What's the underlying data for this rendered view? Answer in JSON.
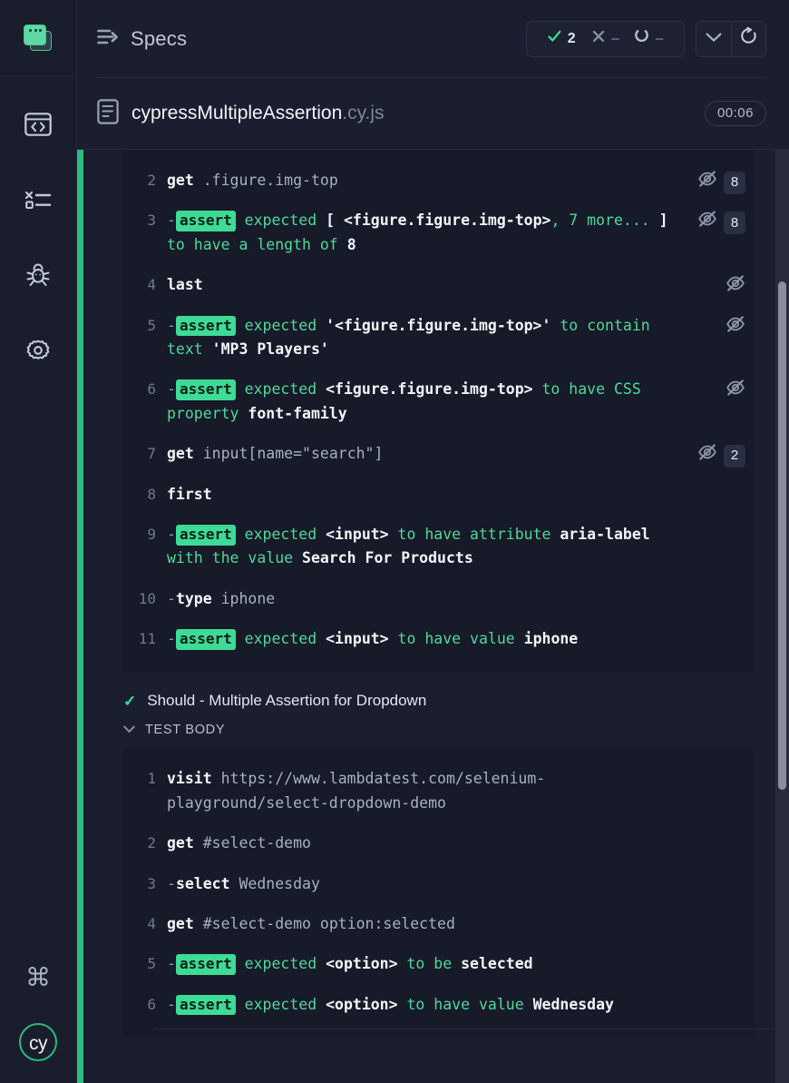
{
  "accent": {
    "green": "#2dbd7f",
    "assert_green": "#3ddb96",
    "code_green": "#4fd89b",
    "bg": "#1b1e2e",
    "code_bg": "#171a28"
  },
  "sidebar": {
    "project_icon": "project-stack-icon",
    "items": [
      {
        "name": "specs",
        "icon": "code-browser-icon"
      },
      {
        "name": "runs",
        "icon": "test-results-list-icon"
      },
      {
        "name": "debug",
        "icon": "bug-icon"
      },
      {
        "name": "settings",
        "icon": "gear-icon"
      }
    ],
    "bottom": [
      {
        "name": "keyboard-shortcuts",
        "icon": "command-key-icon",
        "glyph": "⌘"
      },
      {
        "name": "cypress-logo",
        "icon": "cypress-logo-icon",
        "label": "cy"
      }
    ]
  },
  "header": {
    "icon": "specs-list-arrow-icon",
    "title": "Specs",
    "stats": [
      {
        "name": "passed",
        "icon": "check-icon",
        "value": "2"
      },
      {
        "name": "failed",
        "icon": "x-icon",
        "value": "--"
      },
      {
        "name": "pending",
        "icon": "pending-circle-icon",
        "value": "--"
      }
    ],
    "buttons": [
      {
        "name": "collapse-all",
        "icon": "chevron-down-icon"
      },
      {
        "name": "rerun",
        "icon": "refresh-icon"
      }
    ]
  },
  "spec": {
    "icon": "file-document-icon",
    "name": "cypressMultipleAssertion",
    "extension": ".cy.js",
    "duration": "00:06"
  },
  "blocks": [
    {
      "id": "first-test-log",
      "lines": [
        {
          "num": "2",
          "cmd": "get",
          "arg": ".figure.img-top",
          "kind": "command",
          "hidden_icon": true,
          "count": "8"
        },
        {
          "num": "3",
          "prefix": "-",
          "badge": "assert",
          "message": "expected [ <figure.figure.img-top>, 7 more... ] to have a length of 8",
          "kind": "assert",
          "hidden_icon": true,
          "count": "8"
        },
        {
          "num": "4",
          "cmd": "last",
          "arg": "",
          "kind": "command",
          "hidden_icon": true,
          "count": ""
        },
        {
          "num": "5",
          "prefix": "-",
          "badge": "assert",
          "message": "expected '<figure.figure.img-top>' to contain text 'MP3 Players'",
          "kind": "assert",
          "hidden_icon": true,
          "count": ""
        },
        {
          "num": "6",
          "prefix": "-",
          "badge": "assert",
          "message": "expected <figure.figure.img-top> to have CSS property font-family",
          "kind": "assert",
          "hidden_icon": true,
          "count": ""
        },
        {
          "num": "7",
          "cmd": "get",
          "arg": "input[name=\"search\"]",
          "kind": "command",
          "hidden_icon": true,
          "count": "2"
        },
        {
          "num": "8",
          "cmd": "first",
          "arg": "",
          "kind": "command",
          "hidden_icon": false,
          "count": ""
        },
        {
          "num": "9",
          "prefix": "-",
          "badge": "assert",
          "message": "expected <input> to have attribute aria-label with the value Search For Products",
          "kind": "assert",
          "hidden_icon": false,
          "count": ""
        },
        {
          "num": "10",
          "prefix": "-",
          "cmd": "type",
          "arg": "iphone",
          "kind": "command",
          "hidden_icon": false,
          "count": ""
        },
        {
          "num": "11",
          "prefix": "-",
          "badge": "assert",
          "message": "expected <input> to have value iphone",
          "kind": "assert",
          "hidden_icon": false,
          "count": ""
        }
      ]
    }
  ],
  "test": {
    "status_icon": "check-icon",
    "title": "Should - Multiple Assertion for Dropdown",
    "section_toggle_icon": "chevron-down-icon",
    "section_label": "TEST BODY",
    "lines": [
      {
        "num": "1",
        "cmd": "visit",
        "arg": "https://www.lambdatest.com/selenium-playground/select-dropdown-demo",
        "kind": "command"
      },
      {
        "num": "2",
        "cmd": "get",
        "arg": "#select-demo",
        "kind": "command"
      },
      {
        "num": "3",
        "prefix": "-",
        "cmd": "select",
        "arg": "Wednesday",
        "kind": "command"
      },
      {
        "num": "4",
        "cmd": "get",
        "arg": "#select-demo option:selected",
        "kind": "command"
      },
      {
        "num": "5",
        "prefix": "-",
        "badge": "assert",
        "message": "expected <option> to be selected",
        "kind": "assert"
      },
      {
        "num": "6",
        "prefix": "-",
        "badge": "assert",
        "message": "expected <option> to have value Wednesday",
        "kind": "assert"
      }
    ]
  }
}
